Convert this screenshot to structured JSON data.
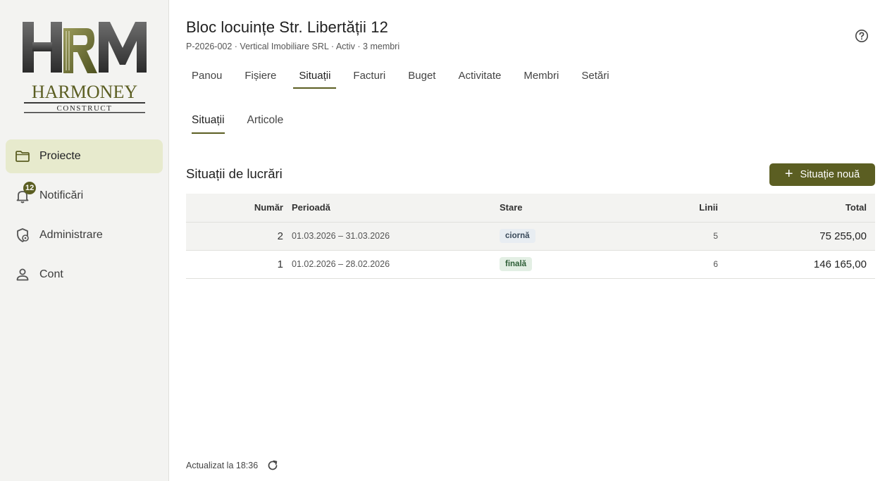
{
  "sidebar": {
    "logo": {
      "monogram": "HRM",
      "name": "HARMONEY",
      "tagline": "CONSTRUCT"
    },
    "items": [
      {
        "label": "Proiecte",
        "icon": "folder-icon",
        "active": true
      },
      {
        "label": "Notificări",
        "icon": "bell-icon",
        "badge": "12"
      },
      {
        "label": "Administrare",
        "icon": "admin-shield-icon"
      },
      {
        "label": "Cont",
        "icon": "person-icon"
      }
    ]
  },
  "header": {
    "title": "Bloc locuințe Str. Libertății 12",
    "subtitle": "P-2026-002 · Vertical Imobiliare SRL · Activ · 3 membri",
    "help_icon": "help-icon"
  },
  "tabs": [
    {
      "label": "Panou"
    },
    {
      "label": "Fișiere"
    },
    {
      "label": "Situații",
      "active": true
    },
    {
      "label": "Facturi"
    },
    {
      "label": "Buget"
    },
    {
      "label": "Activitate"
    },
    {
      "label": "Membri"
    },
    {
      "label": "Setări"
    }
  ],
  "subtabs": [
    {
      "label": "Situații",
      "active": true
    },
    {
      "label": "Articole"
    }
  ],
  "section": {
    "title": "Situații de lucrări",
    "new_button": "Situație nouă"
  },
  "table": {
    "columns": [
      "Număr",
      "Perioadă",
      "Stare",
      "Linii",
      "Total"
    ],
    "rows": [
      {
        "number": "2",
        "period": "01.03.2026 – 31.03.2026",
        "status": "ciornă",
        "lines": "5",
        "total": "75 255,00"
      },
      {
        "number": "1",
        "period": "01.02.2026 – 28.02.2026",
        "status": "finală",
        "lines": "6",
        "total": "146 165,00"
      }
    ]
  },
  "footer": {
    "updated": "Actualizat la 18:36"
  },
  "colors": {
    "accent": "#5b5e22",
    "sidebar_bg": "#f3f3f1",
    "active_nav_bg": "#e7eacd"
  }
}
